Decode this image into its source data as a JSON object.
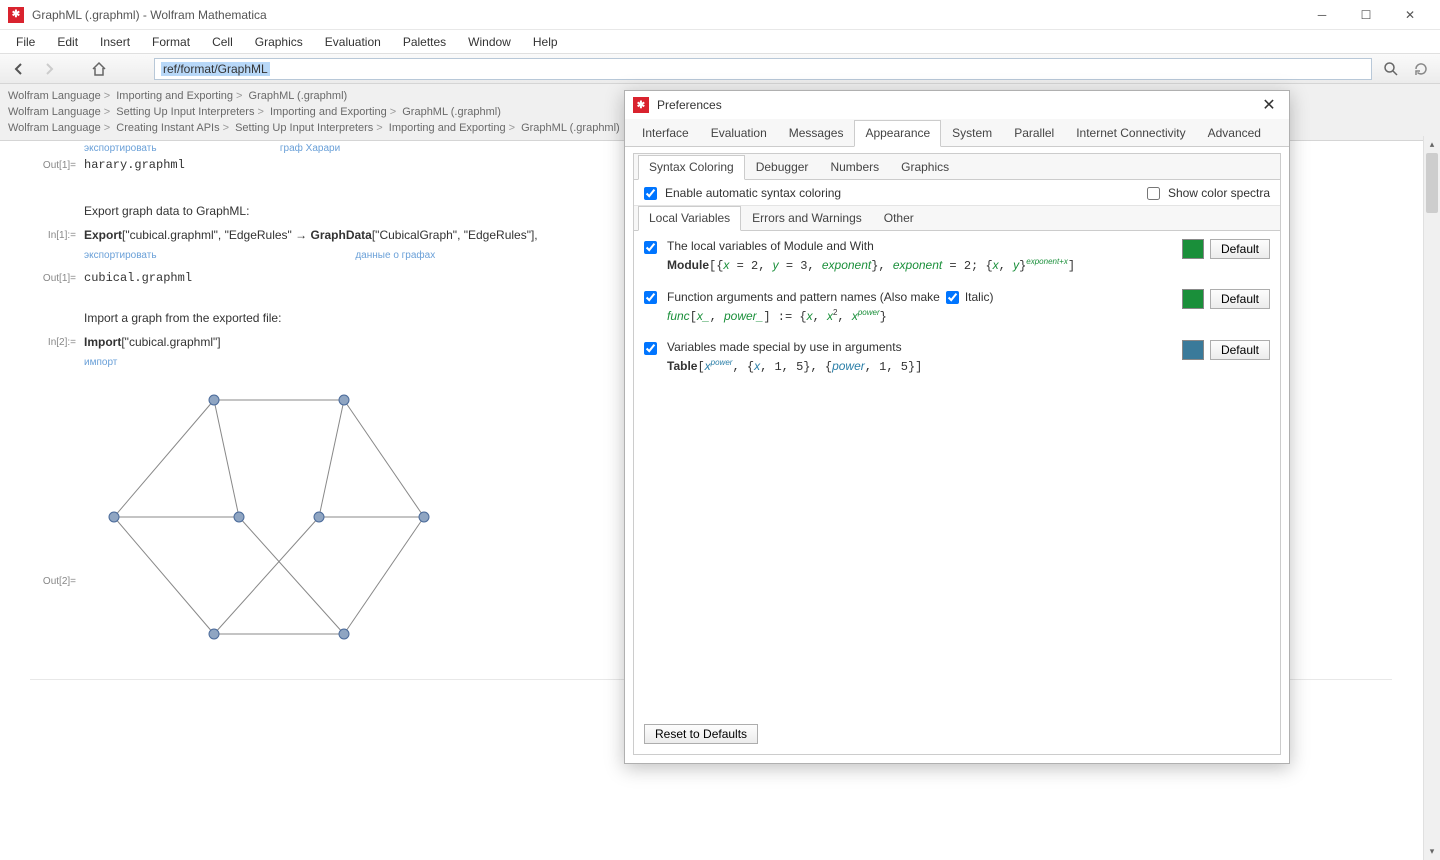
{
  "window": {
    "title": "GraphML (.graphml) - Wolfram Mathematica"
  },
  "menu": {
    "items": [
      "File",
      "Edit",
      "Insert",
      "Format",
      "Cell",
      "Graphics",
      "Evaluation",
      "Palettes",
      "Window",
      "Help"
    ]
  },
  "nav": {
    "address": "ref/format/GraphML"
  },
  "breadcrumbs": {
    "rows": [
      [
        "Wolfram Language",
        "Importing and Exporting",
        "GraphML (.graphml)"
      ],
      [
        "Wolfram Language",
        "Setting Up Input Interpreters",
        "Importing and Exporting",
        "GraphML (.graphml)"
      ],
      [
        "Wolfram Language",
        "Creating Instant APIs",
        "Setting Up Input Interpreters",
        "Importing and Exporting",
        "GraphML (.graphml)"
      ]
    ]
  },
  "notebook": {
    "hint_export": "экспортировать",
    "hint_harary": "граф Харари",
    "out1a_label": "Out[1]=",
    "out1a_value": "harary.graphml",
    "txt_export": "Export graph data to GraphML:",
    "in1_label": "In[1]:=",
    "in1_code_a": "Export",
    "in1_code_b": "[\"cubical.graphml\", \"EdgeRules\" → ",
    "in1_code_c": "GraphData",
    "in1_code_d": "[\"CubicalGraph\", \"EdgeRules\"],",
    "hint_export2": "экспортировать",
    "hint_graphdata": "данные о графах",
    "out1b_label": "Out[1]=",
    "out1b_value": "cubical.graphml",
    "txt_import": "Import a graph from the exported file:",
    "in2_label": "In[2]:=",
    "in2_code_a": "Import",
    "in2_code_b": "[\"cubical.graphml\"]",
    "hint_import": "импорт",
    "out2_label": "Out[2]="
  },
  "prefs": {
    "title": "Preferences",
    "tabs": [
      "Interface",
      "Evaluation",
      "Messages",
      "Appearance",
      "System",
      "Parallel",
      "Internet Connectivity",
      "Advanced"
    ],
    "tabs_active": 3,
    "subtabs": [
      "Syntax Coloring",
      "Debugger",
      "Numbers",
      "Graphics"
    ],
    "subtabs_active": 0,
    "enable_auto": "Enable automatic syntax coloring",
    "show_spectra": "Show color spectra",
    "subsubtabs": [
      "Local Variables",
      "Errors and Warnings",
      "Other"
    ],
    "subsubtabs_active": 0,
    "opts": [
      {
        "label": "The local variables of Module and With",
        "swatch": "#1a8f3a",
        "default": "Default"
      },
      {
        "label": "Function arguments and pattern names  (Also make",
        "italic_label": "Italic)",
        "swatch": "#1a8f3a",
        "default": "Default"
      },
      {
        "label": "Variables made special by use in arguments",
        "swatch": "#3a7a9a",
        "default": "Default"
      }
    ],
    "reset": "Reset to Defaults"
  }
}
